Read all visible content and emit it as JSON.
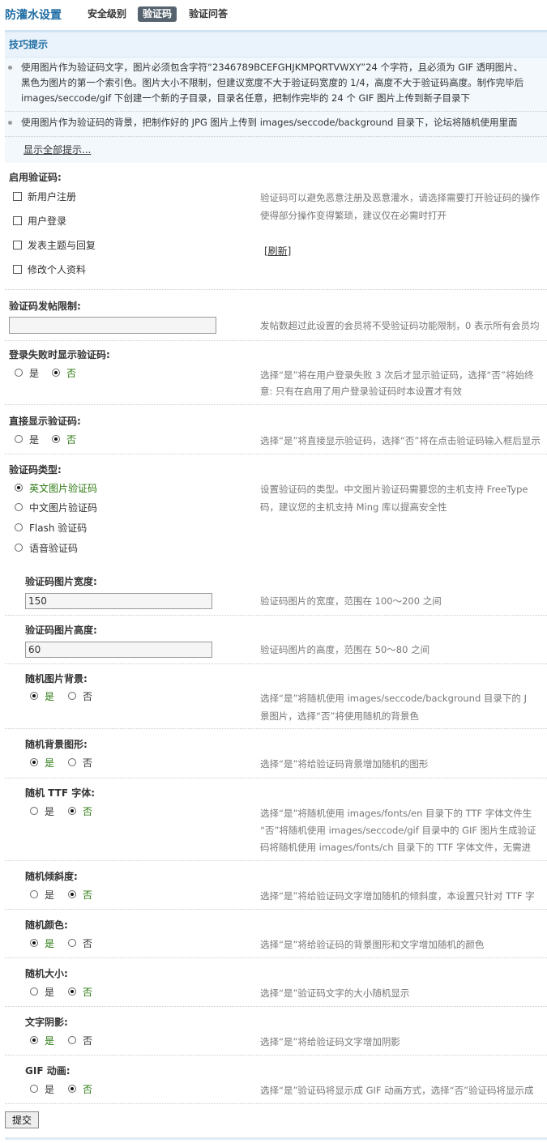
{
  "header": {
    "title": "防灌水设置",
    "tabs": [
      {
        "label": "安全级别",
        "active": false
      },
      {
        "label": "验证码",
        "active": true
      },
      {
        "label": "验证问答",
        "active": false
      }
    ]
  },
  "tips": {
    "heading": "技巧提示",
    "items": [
      {
        "line1": "使用图片作为验证码文字，图片必须包含字符“2346789BCEFGHJKMPQRTVWXY”24 个字符，且必须为 GIF 透明图片、",
        "line2": "黑色为图片的第一个索引色。图片大小不限制，但建议宽度不大于验证码宽度的 1/4，高度不大于验证码高度。制作完毕后",
        "line3": "images/seccode/gif 下创建一个新的子目录，目录名任意，把制作完毕的 24 个 GIF 图片上传到新子目录下"
      },
      {
        "line1": "使用图片作为验证码的背景，把制作好的 JPG 图片上传到 images/seccode/background 目录下，论坛将随机使用里面"
      }
    ],
    "show_all": "显示全部提示..."
  },
  "enable": {
    "label": "启用验证码:",
    "options": [
      "新用户注册",
      "用户登录",
      "发表主题与回复",
      "修改个人资料"
    ],
    "desc_line1": "验证码可以避免恶意注册及恶意灌水，请选择需要打开验证码的操作",
    "desc_line2": "使得部分操作变得繁琐，建议仅在必需时打开",
    "refresh": "[刷新]"
  },
  "post_limit": {
    "label": "验证码发帖限制:",
    "value": "",
    "desc": "发帖数超过此设置的会员将不受验证码功能限制，0 表示所有会员均"
  },
  "login_fail": {
    "label": "登录失败时显示验证码:",
    "yes": "是",
    "no": "否",
    "selected": "no",
    "desc_line1": "选择“是”将在用户登录失败 3 次后才显示验证码，选择“否”将始终",
    "desc_line2": "意: 只有在启用了用户登录验证码时本设置才有效"
  },
  "direct": {
    "label": "直接显示验证码:",
    "yes": "是",
    "no": "否",
    "selected": "no",
    "desc": "选择“是”将直接显示验证码，选择“否”将在点击验证码输入框后显示"
  },
  "type": {
    "label": "验证码类型:",
    "options": [
      "英文图片验证码",
      "中文图片验证码",
      "Flash 验证码",
      "语音验证码"
    ],
    "selected": 0,
    "desc_line1": "设置验证码的类型。中文图片验证码需要您的主机支持 FreeType",
    "desc_line2": "码，建议您的主机支持 Ming 库以提高安全性"
  },
  "width": {
    "label": "验证码图片宽度:",
    "value": "150",
    "desc": "验证码图片的宽度，范围在 100～200 之间"
  },
  "height": {
    "label": "验证码图片高度:",
    "value": "60",
    "desc": "验证码图片的高度，范围在 50～80 之间"
  },
  "random_bg": {
    "label": "随机图片背景:",
    "yes": "是",
    "no": "否",
    "selected": "yes",
    "desc_line1": "选择“是”将随机使用 images/seccode/background 目录下的 J",
    "desc_line2": "景图片，选择“否”将使用随机的背景色"
  },
  "random_shape": {
    "label": "随机背景图形:",
    "yes": "是",
    "no": "否",
    "selected": "yes",
    "desc": "选择“是”将给验证码背景增加随机的图形"
  },
  "random_ttf": {
    "label": "随机 TTF 字体:",
    "yes": "是",
    "no": "否",
    "selected": "no",
    "desc_line1": "选择“是”将随机使用 images/fonts/en 目录下的 TTF 字体文件生",
    "desc_line2": "“否”将随机使用 images/seccode/gif 目录中的 GIF 图片生成验证",
    "desc_line3": "码将随机使用 images/fonts/ch 目录下的 TTF 字体文件，无需进"
  },
  "random_tilt": {
    "label": "随机倾斜度:",
    "yes": "是",
    "no": "否",
    "selected": "no",
    "desc": "选择“是”将给验证码文字增加随机的倾斜度，本设置只针对 TTF 字"
  },
  "random_color": {
    "label": "随机颜色:",
    "yes": "是",
    "no": "否",
    "selected": "yes",
    "desc": "选择“是”将给验证码的背景图形和文字增加随机的颜色"
  },
  "random_size": {
    "label": "随机大小:",
    "yes": "是",
    "no": "否",
    "selected": "no",
    "desc": "选择“是”验证码文字的大小随机显示"
  },
  "shadow": {
    "label": "文字阴影:",
    "yes": "是",
    "no": "否",
    "selected": "yes",
    "desc": "选择“是”将给验证码文字增加阴影"
  },
  "gif_anim": {
    "label": "GIF 动画:",
    "yes": "是",
    "no": "否",
    "selected": "no",
    "desc": "选择“是”验证码将显示成 GIF 动画方式，选择“否”验证码将显示成"
  },
  "submit_label": "提交"
}
